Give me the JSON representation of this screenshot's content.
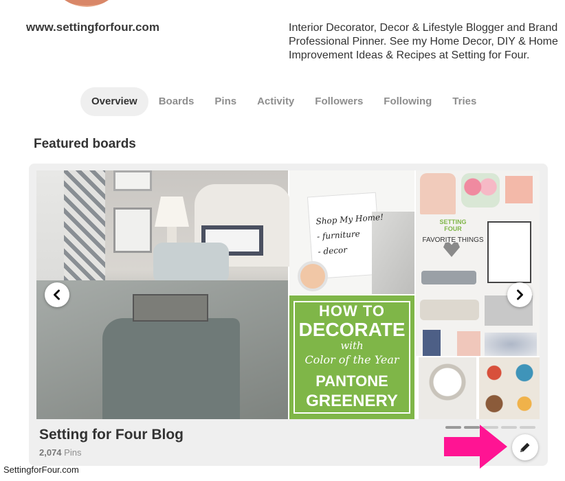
{
  "profile": {
    "website": "www.settingforfour.com",
    "bio": "Interior Decorator, Decor & Lifestyle Blogger and Brand Professional Pinner. See my Home Decor, DIY & Home Improvement Ideas & Recipes at Setting for Four."
  },
  "tabs": [
    {
      "label": "Overview",
      "active": true
    },
    {
      "label": "Boards"
    },
    {
      "label": "Pins"
    },
    {
      "label": "Activity"
    },
    {
      "label": "Followers"
    },
    {
      "label": "Following"
    },
    {
      "label": "Tries"
    }
  ],
  "featured": {
    "section_title": "Featured boards",
    "board_title": "Setting for Four Blog",
    "pin_count": "2,074",
    "pin_label": "Pins",
    "carousel_pages": 5,
    "carousel_active": [
      0,
      1
    ]
  },
  "collage": {
    "shop_lines": [
      "Shop My Home!",
      "- furniture",
      "- decor"
    ],
    "green_lines": [
      "HOW TO",
      "DECORATE",
      "with",
      "Color of the Year",
      "PANTONE",
      "GREENERY"
    ],
    "things_logo": [
      "SETTING",
      "FOUR"
    ],
    "things_title": "FAVORITE THINGS"
  },
  "icons": {
    "prev": "chevron-left-icon",
    "next": "chevron-right-icon",
    "edit": "pencil-icon",
    "pointer": "pink-arrow-icon"
  },
  "colors": {
    "accent_pink": "#ff1493",
    "greenery": "#7fb648",
    "tab_active_bg": "#efefef"
  },
  "watermark": "SettingforFour.com"
}
